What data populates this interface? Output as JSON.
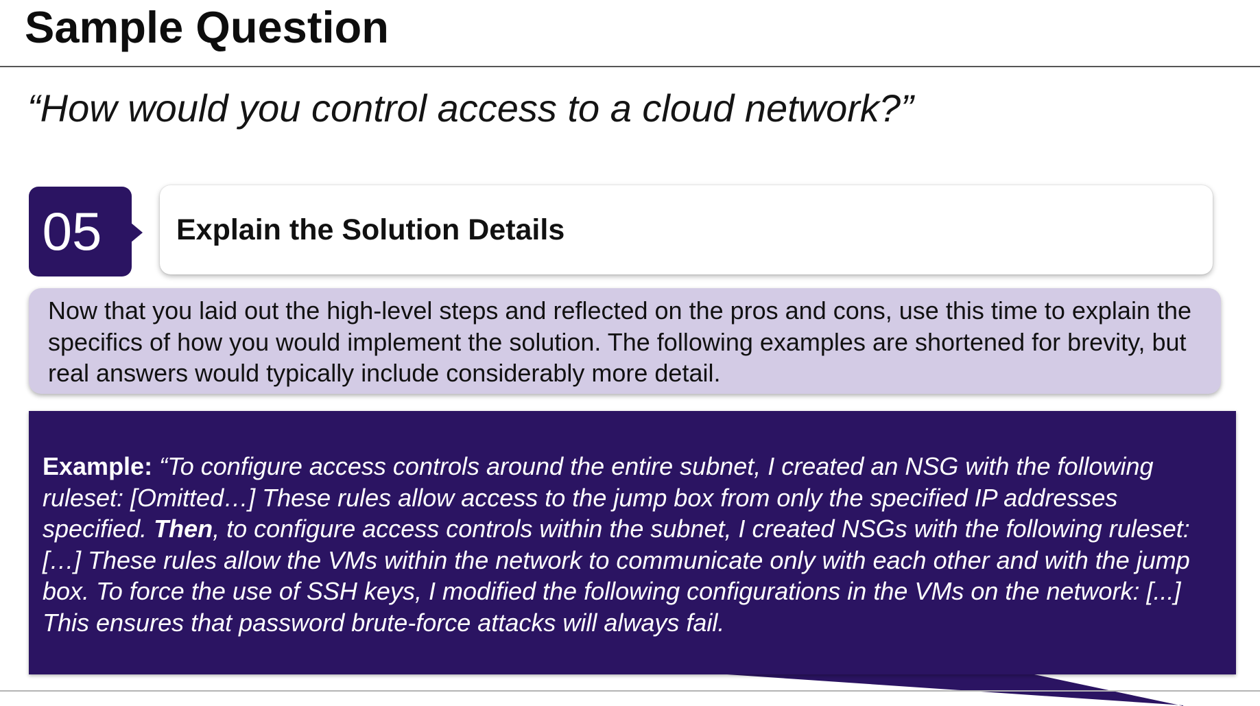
{
  "slide": {
    "title": "Sample Question",
    "question": "“How would you control access to a cloud network?”"
  },
  "step": {
    "number": "05",
    "title": "Explain the Solution Details"
  },
  "intro": {
    "text": "Now that you laid out the high-level steps and reflected on the pros and cons, use this time to explain the specifics of how you would implement the solution. The following examples are shortened for brevity, but real answers would typically include considerably more detail."
  },
  "example": {
    "label": "Example:",
    "text_part1": " “To configure access controls around the entire subnet, I created an NSG with the following ruleset: [Omitted…] These rules allow access to the jump box from only the specified IP addresses specified. ",
    "emphasis": "Then",
    "text_part2": ", to configure access controls within the subnet, I created NSGs with the following ruleset: […] These rules allow the VMs within the network to communicate only with each other and with the jump box. To force the use of SSH keys, I modified the following configurations in the VMs on the network: [...] This ensures that password brute-force attacks will always fail."
  },
  "colors": {
    "brand_dark_purple": "#2b1462",
    "light_lavender": "#d3cbe5"
  }
}
